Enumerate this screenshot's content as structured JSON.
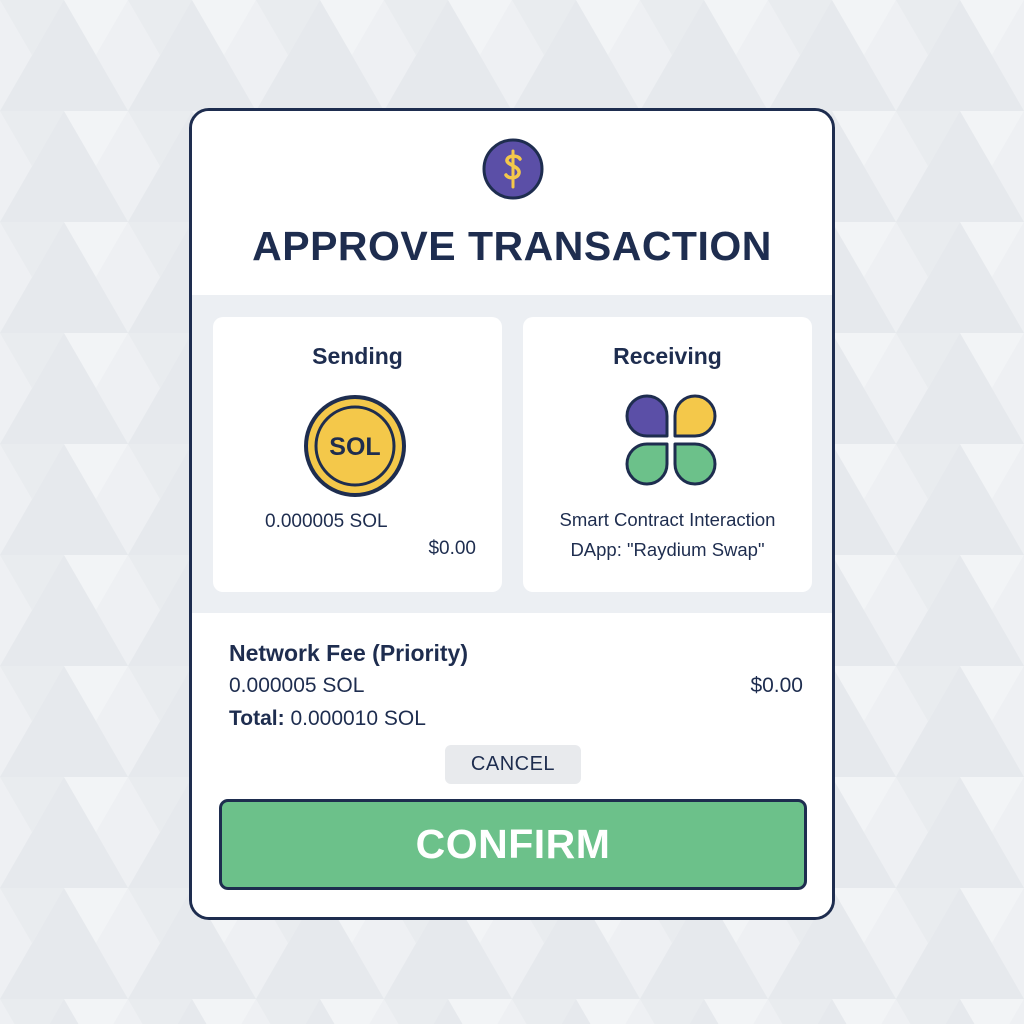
{
  "dialog": {
    "title": "APPROVE TRANSACTION",
    "logo_icon": "dollar-coin-icon"
  },
  "sending": {
    "heading": "Sending",
    "coin_label": "SOL",
    "coin_icon": "sol-coin-icon",
    "amount": "0.000005 SOL",
    "usd": "$0.00"
  },
  "receiving": {
    "heading": "Receiving",
    "icon": "dapp-clover-icon",
    "line1": "Smart Contract Interaction",
    "line2": "DApp: \"Raydium Swap\""
  },
  "fee": {
    "title": "Network Fee (Priority)",
    "amount": "0.000005 SOL",
    "usd": "$0.00",
    "total_label": "Total:",
    "total_value": "0.000010 SOL"
  },
  "actions": {
    "cancel_label": "CANCEL",
    "confirm_label": "CONFIRM"
  },
  "colors": {
    "navy": "#1e2d4f",
    "purple": "#5b4fa7",
    "gold": "#f4c84a",
    "green": "#6cc18a"
  }
}
